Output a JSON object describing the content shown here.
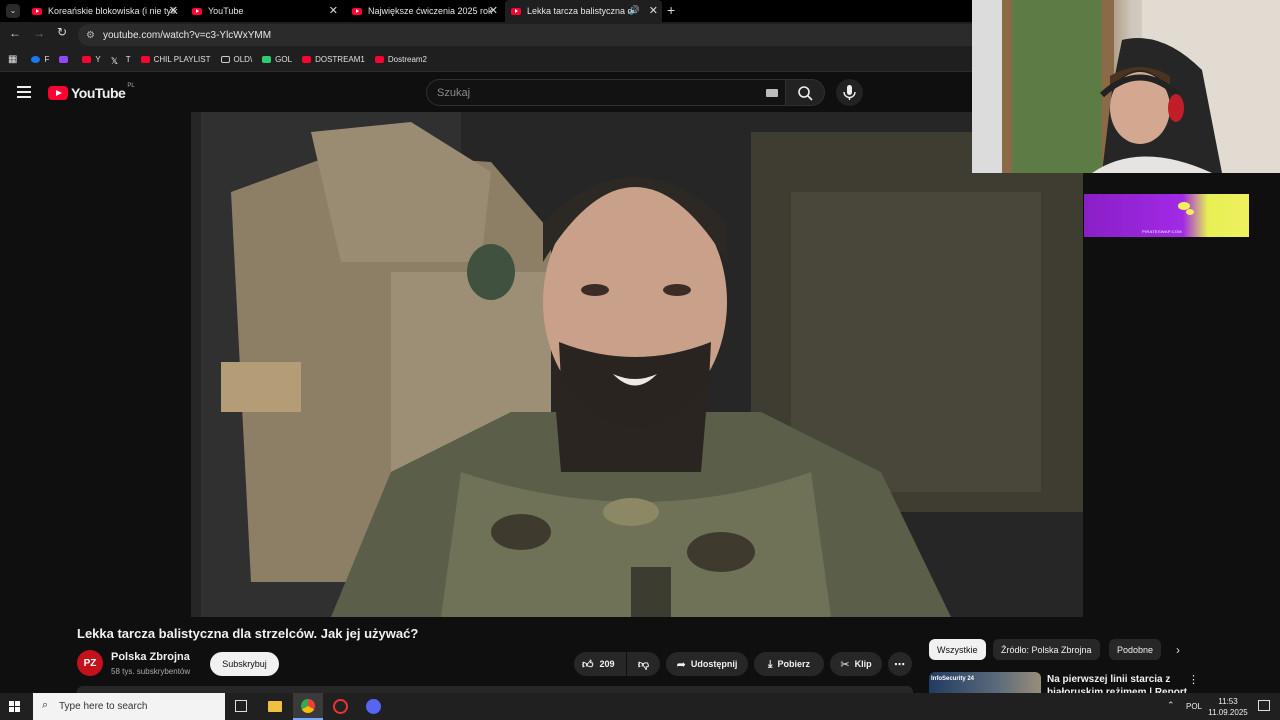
{
  "tabs": [
    {
      "title": "Koreańskie blokowiska (i nie tylk",
      "active": false
    },
    {
      "title": "YouTube",
      "active": false
    },
    {
      "title": "Największe ćwiczenia 2025 rok",
      "active": false
    },
    {
      "title": "Lekka tarcza balistyczna dla",
      "active": true
    }
  ],
  "address": {
    "url": "youtube.com/watch?v=c3-YlcWxYMM"
  },
  "bookmarks": [
    {
      "label": "F",
      "color": "#1877f2"
    },
    {
      "label": "",
      "color": "#9146ff"
    },
    {
      "label": "Y",
      "color": "#ff0033"
    },
    {
      "label": "T",
      "color": "#ffffff"
    },
    {
      "label": "CHIL PLAYLIST",
      "color": "#ff0033"
    },
    {
      "label": "OLD\\",
      "color": "folder"
    },
    {
      "label": "GOL",
      "color": "#2ecc71"
    },
    {
      "label": "DOSTREAM1",
      "color": "#ff0033"
    },
    {
      "label": "Dostream2",
      "color": "#ff0033"
    }
  ],
  "youtube": {
    "logo": "YouTube",
    "region": "PL",
    "search_placeholder": "Szukaj"
  },
  "video": {
    "title": "Lekka tarcza balistyczna dla strzelców. Jak jej używać?",
    "channel_initials": "PZ",
    "channel_name": "Polska Zbrojna",
    "channel_subs": "58 tys. subskrybentów",
    "subscribe_label": "Subskrybuj",
    "likes": "209",
    "share_label": "Udostępnij",
    "download_label": "Pobierz",
    "clip_label": "Klip"
  },
  "chips": [
    "Wszystkie",
    "Źródło: Polska Zbrojna",
    "Podobne"
  ],
  "recommendation": {
    "thumb_label": "InfoSecurity 24",
    "title_line1": "Na pierwszej linii starcia z",
    "title_line2": "białoruskim reżimem | Report"
  },
  "banner_text": "PIRATESWAP.COM",
  "taskbar": {
    "search_placeholder": "Type here to search",
    "lang": "POL",
    "time": "11:53",
    "date": "11.09.2025"
  },
  "colors": {
    "youtube_red": "#ff0033",
    "bg": "#0f0f0f",
    "chip_bg": "#272727"
  }
}
